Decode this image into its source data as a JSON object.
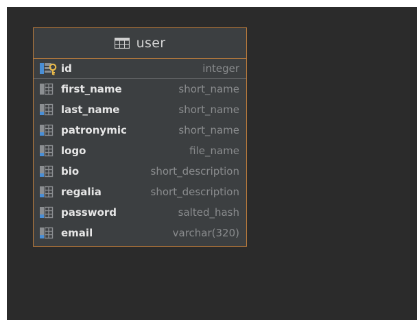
{
  "entity": {
    "title": "user",
    "primary_key": {
      "name": "id",
      "type": "integer"
    },
    "columns": [
      {
        "name": "first_name",
        "type": "short_name"
      },
      {
        "name": "last_name",
        "type": "short_name"
      },
      {
        "name": "patronymic",
        "type": "short_name"
      },
      {
        "name": "logo",
        "type": "file_name"
      },
      {
        "name": "bio",
        "type": "short_description"
      },
      {
        "name": "regalia",
        "type": "short_description"
      },
      {
        "name": "password",
        "type": "salted_hash"
      },
      {
        "name": "email",
        "type": "varchar(320)"
      }
    ]
  },
  "colors": {
    "canvas_background": "#2b2b2b",
    "entity_border": "#b87a3c",
    "entity_background": "#3c3f41",
    "column_icon_blue": "#4a8fd6",
    "column_icon_grey": "#8c8f92",
    "key_icon": "#e8b94a",
    "type_text": "#8a8c8e"
  },
  "icons": {
    "table": "table-icon",
    "primary_key_column": "primary-key-column-icon",
    "column": "column-icon"
  }
}
